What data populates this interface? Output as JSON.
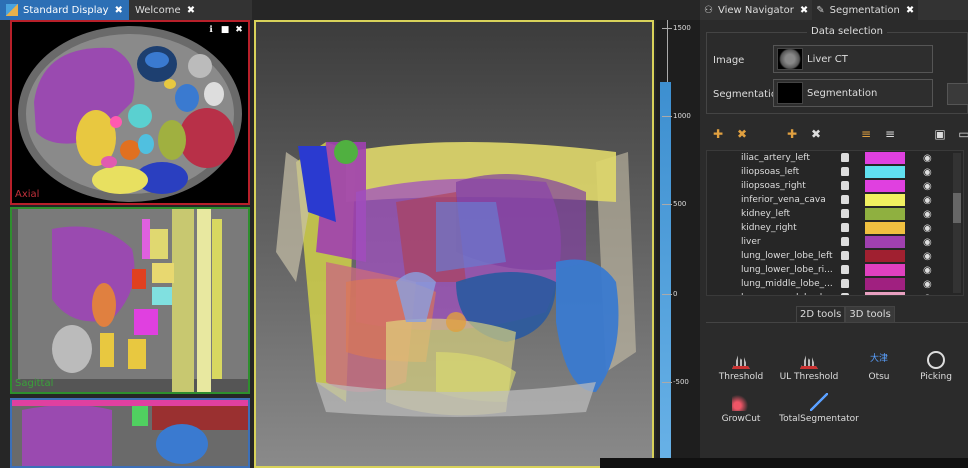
{
  "left_tabs": [
    {
      "label": "Standard Display",
      "active": true
    },
    {
      "label": "Welcome",
      "active": false
    }
  ],
  "viewers": {
    "axial_label": "Axial",
    "sagittal_label": "Sagittal"
  },
  "scale": {
    "ticks": [
      "1500",
      "1000",
      "500",
      "0",
      "-500"
    ]
  },
  "right_tabs": [
    {
      "label": "View Navigator",
      "icon": "binoculars-icon"
    },
    {
      "label": "Segmentation",
      "icon": "brush-icon"
    }
  ],
  "data_selection": {
    "title": "Data selection",
    "image_label": "Image",
    "image_value": "Liver CT",
    "seg_label": "Segmentation",
    "seg_value": "Segmentation"
  },
  "segments": [
    {
      "name": "iliac_artery_left",
      "color": "#e040e0"
    },
    {
      "name": "iliopsoas_left",
      "color": "#60e0f0"
    },
    {
      "name": "iliopsoas_right",
      "color": "#e040e0"
    },
    {
      "name": "inferior_vena_cava",
      "color": "#f0f060"
    },
    {
      "name": "kidney_left",
      "color": "#8fb040"
    },
    {
      "name": "kidney_right",
      "color": "#f0c040"
    },
    {
      "name": "liver",
      "color": "#a040b0"
    },
    {
      "name": "lung_lower_lobe_left",
      "color": "#a02030"
    },
    {
      "name": "lung_lower_lobe_ri...",
      "color": "#e040c0"
    },
    {
      "name": "lung_middle_lobe_...",
      "color": "#a02080"
    },
    {
      "name": "lung_upper_lobe_l...",
      "color": "#e8a0c0"
    }
  ],
  "tool_tabs": [
    {
      "label": "2D tools",
      "active": false
    },
    {
      "label": "3D tools",
      "active": true
    }
  ],
  "tools": [
    {
      "label": "Threshold",
      "icon": "histogram-icon"
    },
    {
      "label": "UL Threshold",
      "icon": "histogram-icon"
    },
    {
      "label": "Otsu",
      "icon": "otsu-icon",
      "glyph": "大津"
    },
    {
      "label": "Picking",
      "icon": "picking-icon"
    },
    {
      "label": "GrowCut",
      "icon": "growcut-icon"
    },
    {
      "label": "TotalSegmentator",
      "icon": "totalsegmentator-icon"
    }
  ]
}
